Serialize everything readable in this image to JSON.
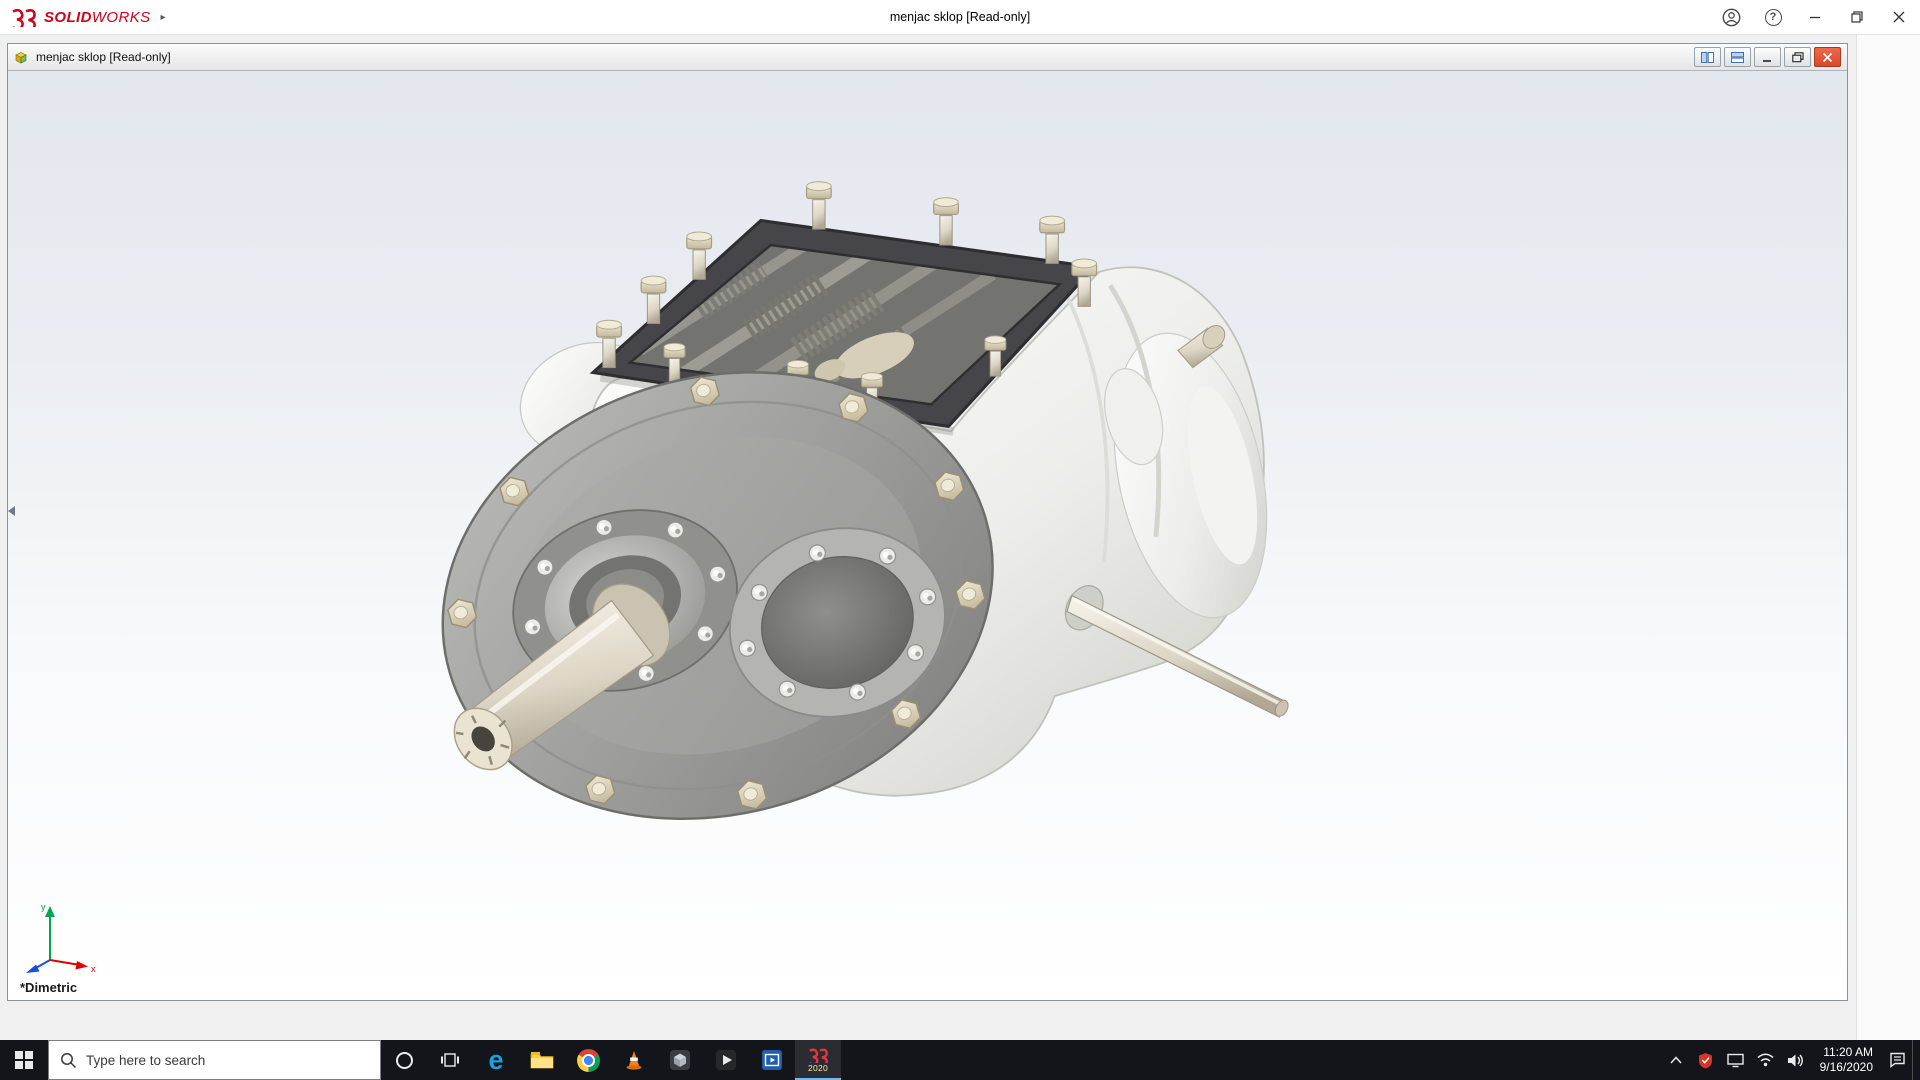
{
  "app_titlebar": {
    "brand_bold": "SOLID",
    "brand_light": "WORKS",
    "title": "menjac sklop [Read-only]"
  },
  "doc_window": {
    "title": "menjac sklop [Read-only]",
    "view_label": "*Dimetric"
  },
  "viewport": {
    "triad": {
      "x_label": "x",
      "y_label": "y"
    }
  },
  "icons": {
    "help_glyph": "?",
    "edge_glyph": "e",
    "flyout_arrow": "▸"
  },
  "taskbar": {
    "search_placeholder": "Type here to search",
    "solidworks_year": "2020",
    "clock": {
      "time": "11:20 AM",
      "date": "9/16/2020"
    }
  },
  "colors": {
    "brand_red": "#d1021b",
    "taskbar_bg": "#14151a",
    "doc_close_red": "#d9472b",
    "viewport_gradient_top": "#e3e7ee"
  }
}
